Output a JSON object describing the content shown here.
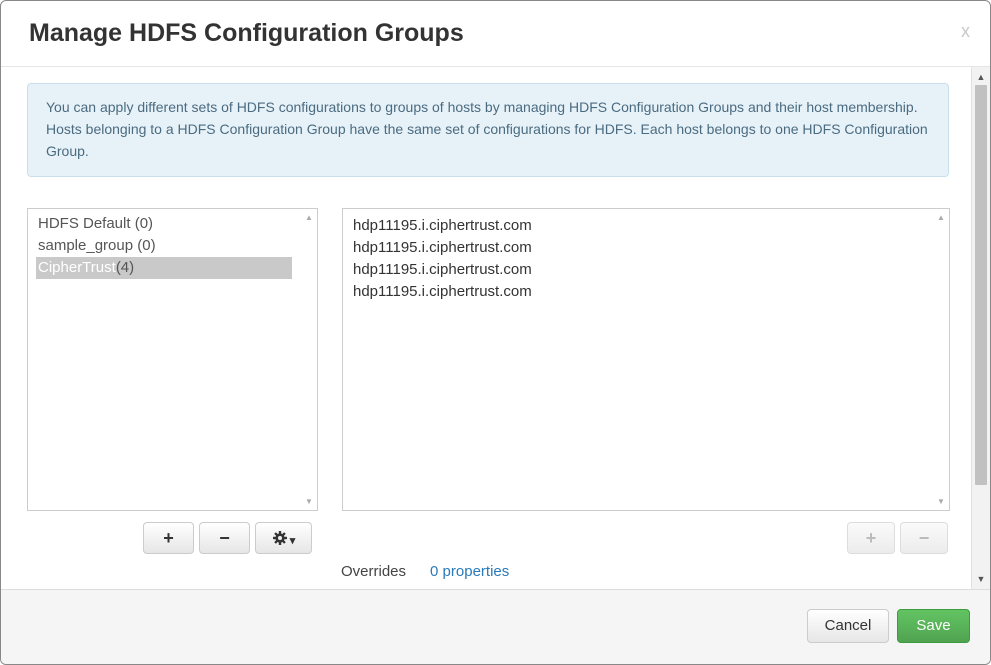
{
  "dialog": {
    "title": "Manage HDFS Configuration Groups",
    "close_label": "x"
  },
  "info": {
    "text": "You can apply different sets of HDFS configurations to groups of hosts by managing HDFS Configuration Groups and their host membership. Hosts belonging to a HDFS Configuration Group have the same set of configurations for HDFS. Each host belongs to one HDFS Configuration Group."
  },
  "groups": [
    {
      "name": "HDFS Default",
      "count": " (0)"
    },
    {
      "name": "sample_group",
      "count": " (0)"
    },
    {
      "name": "CipherTrust",
      "count": "(4)",
      "selected": true
    }
  ],
  "hosts": [
    "hdp11195.i.ciphertrust.com",
    "hdp11195.i.ciphertrust.com",
    "hdp11195.i.ciphertrust.com",
    "hdp11195.i.ciphertrust.com"
  ],
  "group_buttons": {
    "add": "+",
    "remove": "−",
    "settings_icon": "gear-icon",
    "caret": "▾"
  },
  "host_buttons": {
    "add": "+",
    "remove": "−"
  },
  "overrides": {
    "label": "Overrides",
    "link": "0 properties"
  },
  "footer": {
    "cancel": "Cancel",
    "save": "Save"
  },
  "colors": {
    "save": "#5bb75b",
    "info_bg": "#e7f2f8",
    "link": "#2a7ab8"
  }
}
